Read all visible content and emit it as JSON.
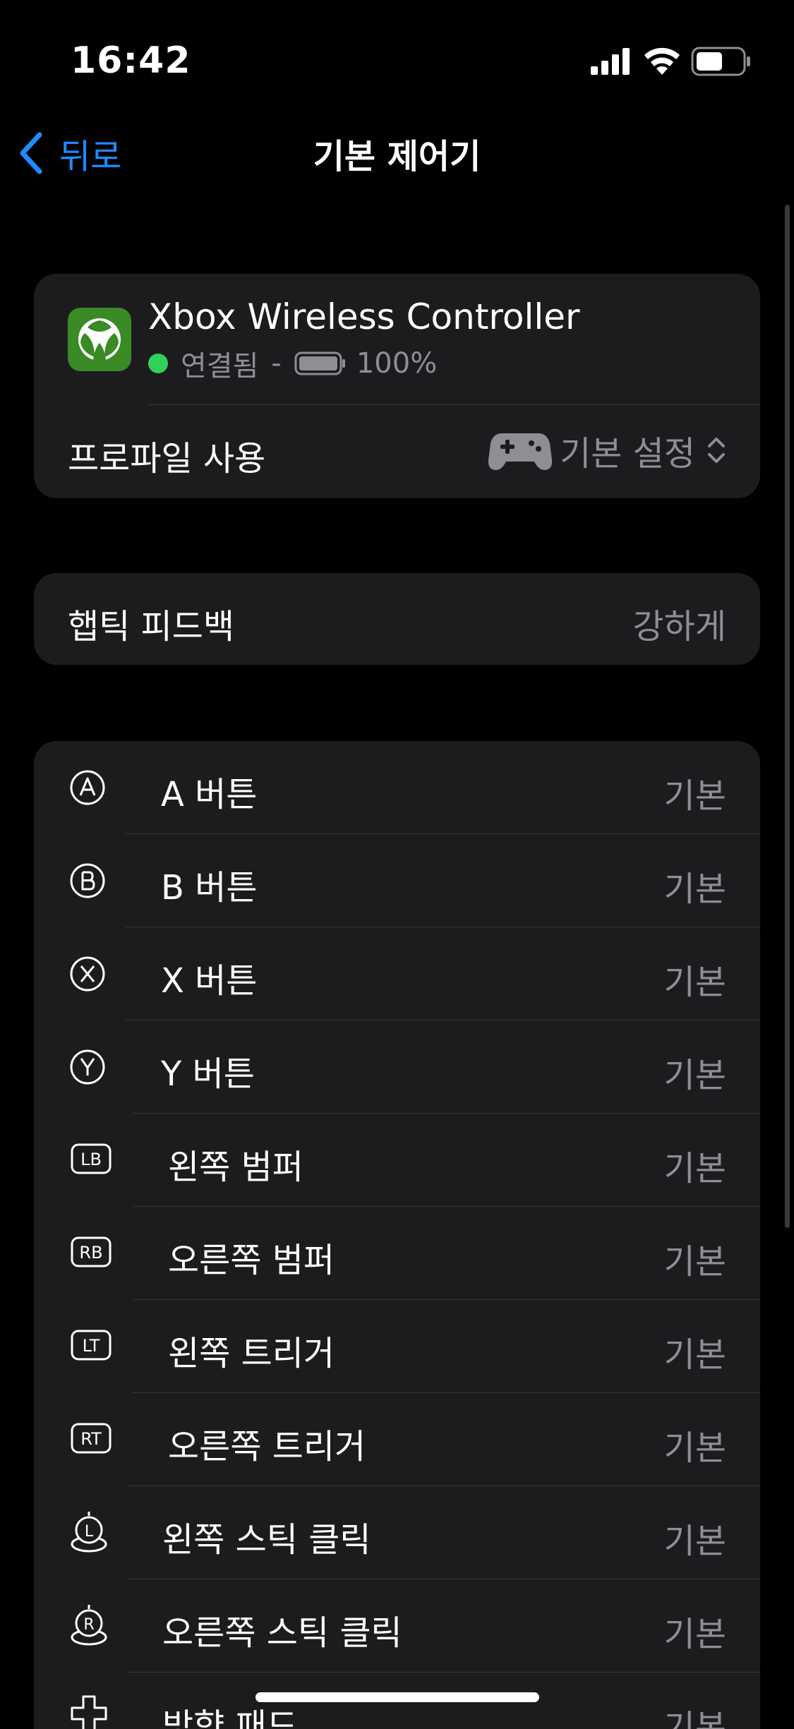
{
  "status_bar": {
    "time": "16:42",
    "icons": [
      "cellular-signal-icon",
      "wifi-icon",
      "battery-icon"
    ]
  },
  "nav": {
    "back_label": "뒤로",
    "title": "기본 제어기"
  },
  "controller": {
    "name": "Xbox Wireless Controller",
    "status": "연결됨",
    "separator": "-",
    "battery": "100%",
    "icon": "xbox-logo-icon"
  },
  "profile": {
    "label": "프로파일 사용",
    "value": "기본 설정"
  },
  "haptic": {
    "label": "햅틱 피드백",
    "value": "강하게"
  },
  "buttons": [
    {
      "icon": "A",
      "label": "A 버튼",
      "value": "기본"
    },
    {
      "icon": "B",
      "label": "B 버튼",
      "value": "기본"
    },
    {
      "icon": "X",
      "label": "X 버튼",
      "value": "기본"
    },
    {
      "icon": "Y",
      "label": "Y 버튼",
      "value": "기본"
    },
    {
      "icon": "LB",
      "label": "왼쪽 범퍼",
      "value": "기본"
    },
    {
      "icon": "RB",
      "label": "오른쪽 범퍼",
      "value": "기본"
    },
    {
      "icon": "LT",
      "label": "왼쪽 트리거",
      "value": "기본"
    },
    {
      "icon": "RT",
      "label": "오른쪽 트리거",
      "value": "기본"
    },
    {
      "icon": "L",
      "label": "왼쪽 스틱 클릭",
      "value": "기본"
    },
    {
      "icon": "R",
      "label": "오른쪽 스틱 클릭",
      "value": "기본"
    },
    {
      "icon": "dpad",
      "label": "방향 패드",
      "value": "기본"
    }
  ],
  "colors": {
    "background": "#000000",
    "card": "#1c1c1e",
    "accent": "#1e8cff",
    "connected": "#30d158",
    "secondary_text": "#8e8e93",
    "xbox_green": "#3a8a26"
  }
}
